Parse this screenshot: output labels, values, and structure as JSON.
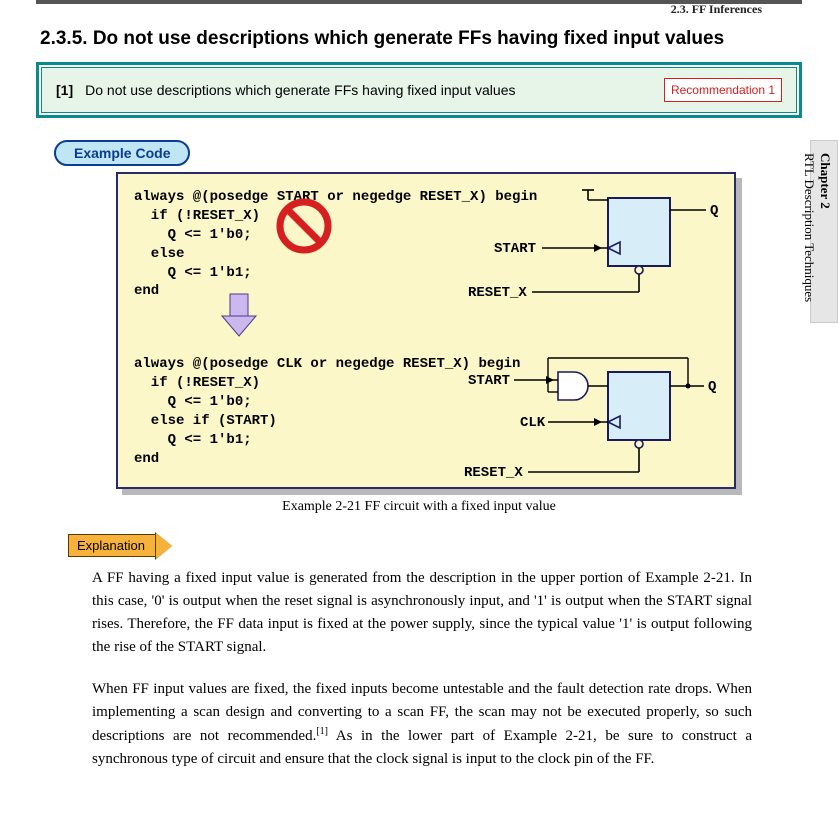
{
  "header": {
    "crumb": "2.3. FF Inferences"
  },
  "headline": {
    "num": "2.3.5.",
    "title": "Do not use descriptions which generate FFs having fixed input values"
  },
  "rule": {
    "num": "[1]",
    "text": "Do not use descriptions which generate FFs having fixed input values",
    "badge": "Recommendation 1"
  },
  "example_pill": "Example Code",
  "code": {
    "block1_l1": "always @(posedge START or negedge RESET_X) begin",
    "block1_l2": "  if (!RESET_X)",
    "block1_l3": "    Q <= 1'b0;",
    "block1_l4": "  else",
    "block1_l5": "    Q <= 1'b1;",
    "block1_l6": "end",
    "block2_l1": "always @(posedge CLK or negedge RESET_X) begin",
    "block2_l2": "  if (!RESET_X)",
    "block2_l3": "    Q <= 1'b0;",
    "block2_l4": "  else if (START)",
    "block2_l5": "    Q <= 1'b1;",
    "block2_l6": "end"
  },
  "diagram": {
    "ff1": {
      "q": "Q",
      "clk": "START",
      "rst": "RESET_X"
    },
    "ff2": {
      "q": "Q",
      "d": "START",
      "clk": "CLK",
      "rst": "RESET_X"
    }
  },
  "figure_caption": "Example 2-21  FF circuit with a fixed input value",
  "explanation_label": "Explanation",
  "explanation": {
    "p1": "A FF having a fixed input value is generated from the description in the upper portion of Example 2-21.  In this case, '0' is output when the reset signal is asynchronously input, and  '1' is output when the START signal rises.  Therefore, the FF data input is fixed at the power supply, since the typical value  '1' is output following the rise of the START signal.",
    "p2_a": "When FF input values are fixed, the fixed inputs become untestable and the fault detection rate drops.  When implementing a scan design and converting to a scan FF, the scan may not be executed properly, so such descriptions are not recommended.",
    "p2_sup": "[1]",
    "p2_b": "  As in the lower part of Example 2-21, be sure to construct a synchronous type of circuit and ensure that the clock signal is input to the clock pin of the FF."
  },
  "side": {
    "chapter": "Chapter 2",
    "title": "RTL Description Techniques"
  }
}
